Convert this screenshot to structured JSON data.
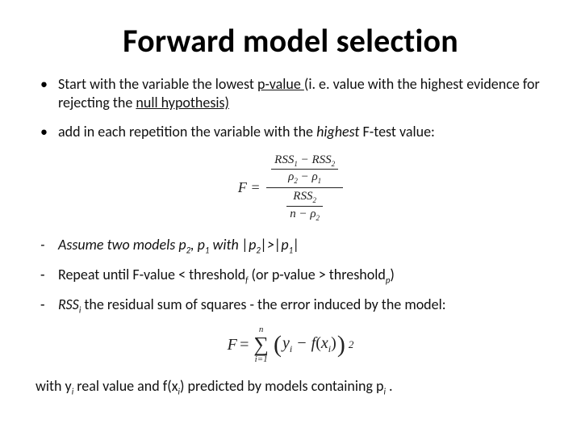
{
  "title": "Forward model selection",
  "b1_a": "Start  with the variable the lowest ",
  "b1_u1": "p-value ",
  "b1_b": "(i. e. value with the highest evidence for rejecting the ",
  "b1_u2": "null hypothesis)",
  "b2_a": "add in each repetition the variable with the ",
  "b2_i": "highest ",
  "b2_b": "F-test value:",
  "eqF": "F",
  "eq_eq": " = ",
  "rss1": "RSS",
  "one": "1",
  "minus": " − ",
  "rss2a": "RSS",
  "two": "2",
  "rho2": "ρ",
  "rho1": "ρ",
  "rss2b": "RSS",
  "n": "n",
  "d1_a": "Assume two models ",
  "d1_p2": "p",
  "d1_s2": "2",
  "d1_comma": ", ",
  "d1_p1": "p",
  "d1_s1": "1",
  "d1_with": " with |",
  "d1_p2b": "p",
  "d1_s2b": "2",
  "d1_gt": "|>|",
  "d1_p1b": "p",
  "d1_s1b": "1",
  "d1_end": "|",
  "d2_a": "Repeat until F-value < threshold",
  "d2_sf": "f",
  "d2_b": " (or p-value > threshold",
  "d2_sp": "p",
  "d2_c": ")",
  "d3_a": "RSS",
  "d3_i": "i",
  "d3_b": " the residual sum of squares - the error induced by the model:",
  "sumF": "F",
  "sum_eq": " = ",
  "sum_top": "n",
  "sum_bot": "i=1",
  "yi": "y",
  "yi_i": "i",
  "s_minus": " − ",
  "fx_f": "f",
  "fx_lp": "(",
  "fx_x": "x",
  "fx_i": "i",
  "fx_rp": ")",
  "sq2": "2",
  "foot_a": "with y",
  "foot_i1": "i",
  "foot_b": "  real value and f(x",
  "foot_i2": "i",
  "foot_c": ")  predicted by  models containing  p",
  "foot_i3": "i",
  "foot_d": "  ."
}
